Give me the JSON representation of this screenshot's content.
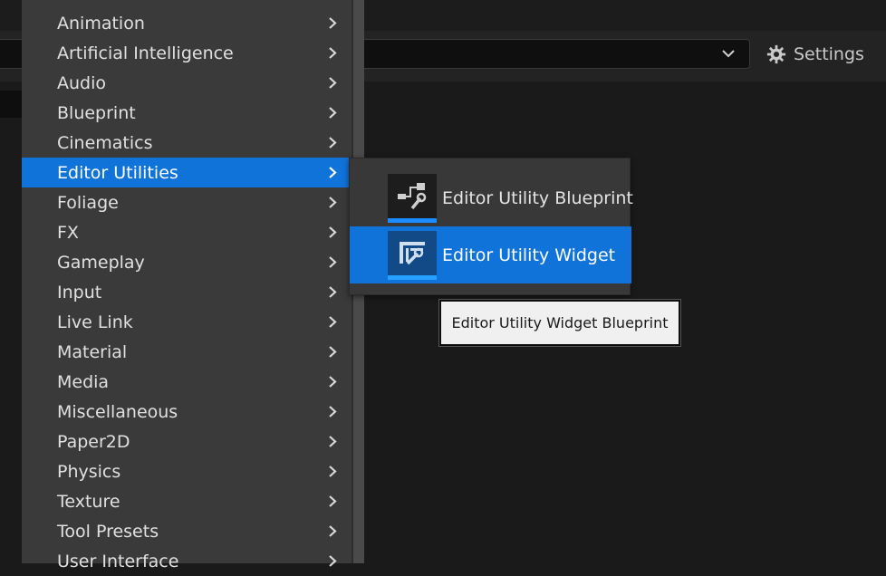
{
  "toolbar": {
    "settings_label": "Settings"
  },
  "menu": {
    "items": [
      {
        "label": "Animation"
      },
      {
        "label": "Artificial Intelligence"
      },
      {
        "label": "Audio"
      },
      {
        "label": "Blueprint"
      },
      {
        "label": "Cinematics"
      },
      {
        "label": "Editor Utilities"
      },
      {
        "label": "Foliage"
      },
      {
        "label": "FX"
      },
      {
        "label": "Gameplay"
      },
      {
        "label": "Input"
      },
      {
        "label": "Live Link"
      },
      {
        "label": "Material"
      },
      {
        "label": "Media"
      },
      {
        "label": "Miscellaneous"
      },
      {
        "label": "Paper2D"
      },
      {
        "label": "Physics"
      },
      {
        "label": "Texture"
      },
      {
        "label": "Tool Presets"
      },
      {
        "label": "User Interface"
      }
    ],
    "selected": "Editor Utilities"
  },
  "submenu": {
    "items": [
      {
        "label": "Editor Utility Blueprint",
        "icon": "blueprint-wrench-icon"
      },
      {
        "label": "Editor Utility Widget",
        "icon": "widget-wrench-icon"
      }
    ],
    "selected": "Editor Utility Widget"
  },
  "tooltip": {
    "text": "Editor Utility Widget Blueprint"
  },
  "colors": {
    "accent": "#1073d9",
    "menu_bg": "#3a3a3a",
    "tooltip_bg": "#f0f0f0"
  }
}
